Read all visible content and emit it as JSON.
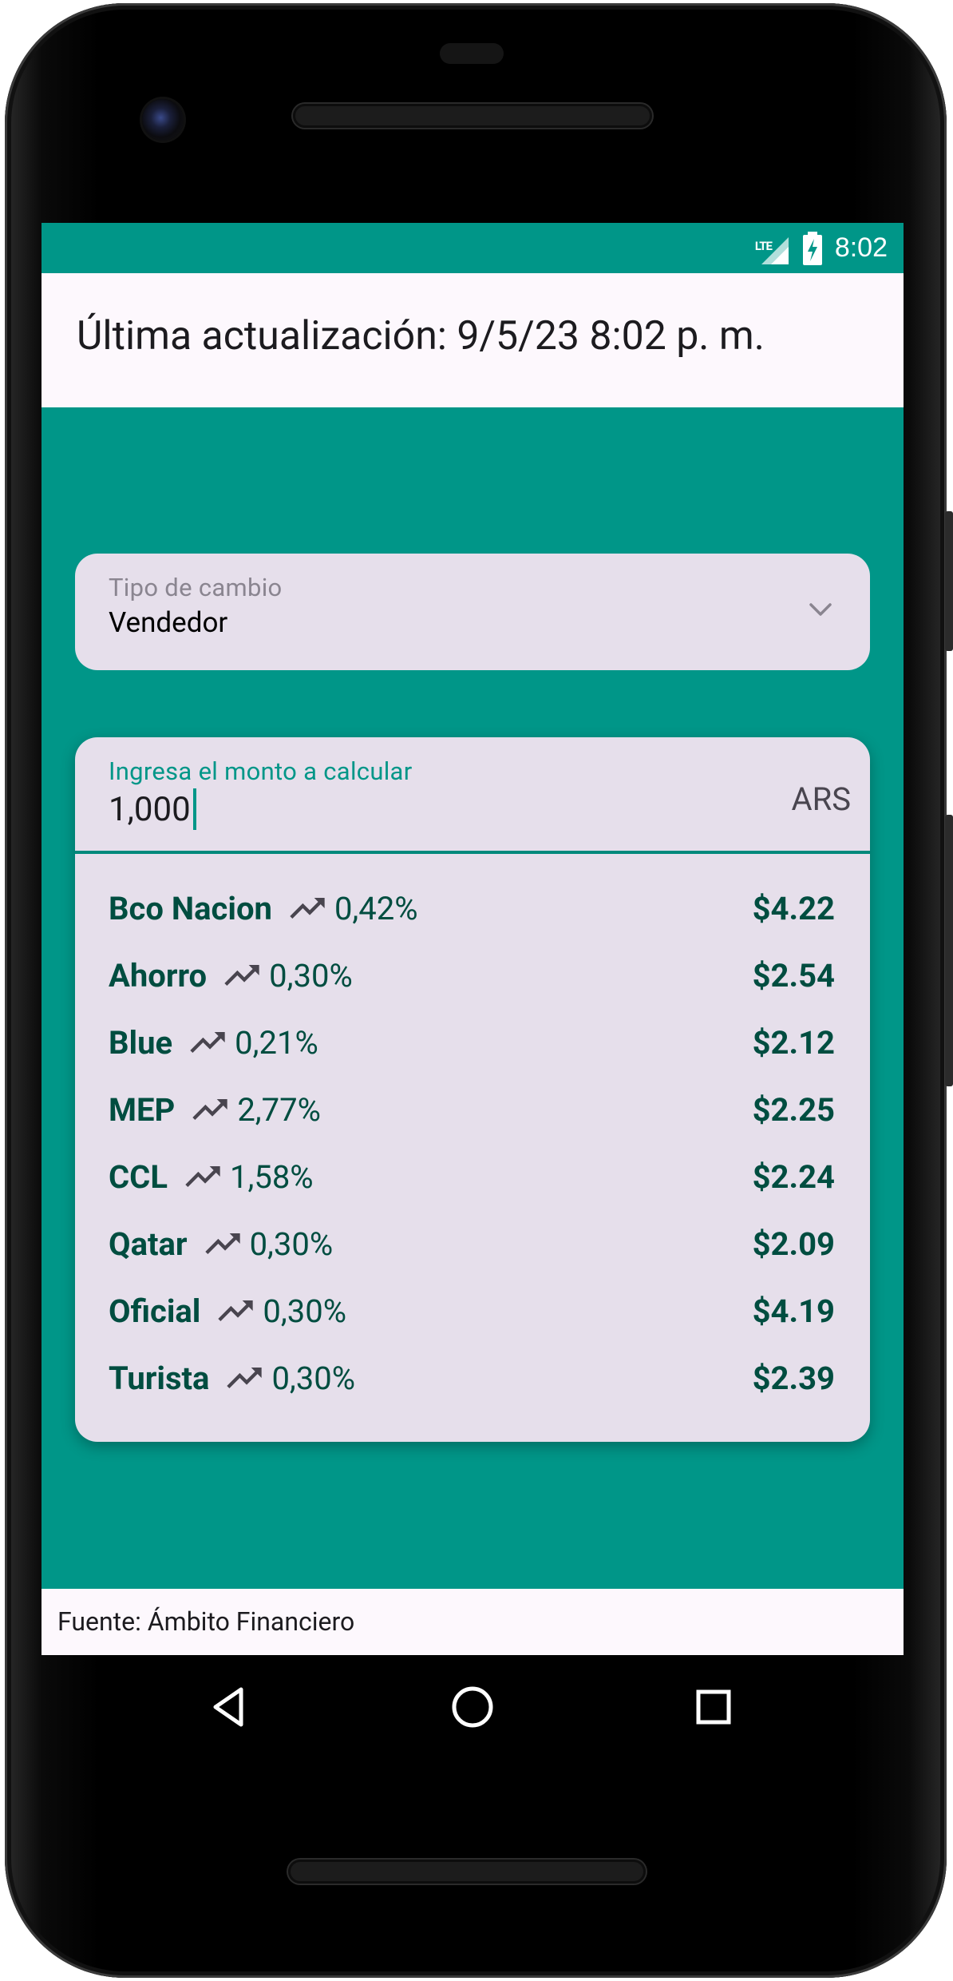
{
  "status_bar": {
    "network_label": "LTE",
    "time": "8:02"
  },
  "header": {
    "last_update": "Última actualización: 9/5/23 8:02 p. m."
  },
  "exchange_type": {
    "label": "Tipo de cambio",
    "value": "Vendedor"
  },
  "amount_input": {
    "label": "Ingresa el monto a calcular",
    "value": "1,000",
    "suffix": "ARS"
  },
  "rates": [
    {
      "name": "Bco Nacion",
      "change": "0,42%",
      "value": "$4.22"
    },
    {
      "name": "Ahorro",
      "change": "0,30%",
      "value": "$2.54"
    },
    {
      "name": "Blue",
      "change": "0,21%",
      "value": "$2.12"
    },
    {
      "name": "MEP",
      "change": "2,77%",
      "value": "$2.25"
    },
    {
      "name": "CCL",
      "change": "1,58%",
      "value": "$2.24"
    },
    {
      "name": "Qatar",
      "change": "0,30%",
      "value": "$2.09"
    },
    {
      "name": "Oficial",
      "change": "0,30%",
      "value": "$4.19"
    },
    {
      "name": "Turista",
      "change": "0,30%",
      "value": "$2.39"
    }
  ],
  "footer": {
    "source": "Fuente: Ámbito Financiero"
  },
  "icons": {
    "trend": "trending-up-icon",
    "dropdown": "chevron-down-icon",
    "nav_back": "back-triangle-icon",
    "nav_home": "home-circle-icon",
    "nav_recents": "recents-square-icon"
  },
  "colors": {
    "primary": "#009688",
    "primary_dark_text": "#004d40",
    "surface": "#e6dfeb",
    "background_light": "#fdf8fd"
  }
}
